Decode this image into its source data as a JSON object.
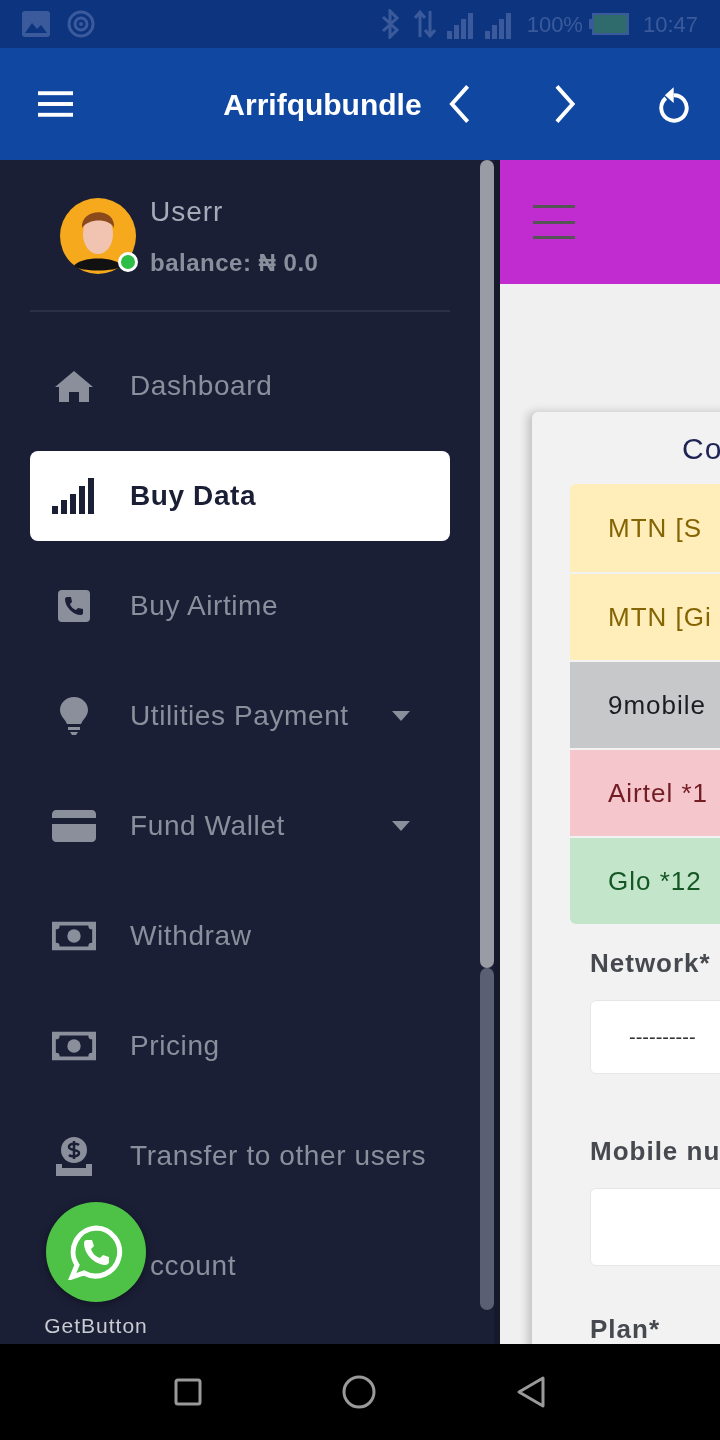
{
  "status_bar": {
    "battery": "100%",
    "time": "10:47"
  },
  "app_bar": {
    "title": "Arrifqubundle"
  },
  "profile": {
    "name": "Userr",
    "balance": "balance: ₦ 0.0",
    "online": true
  },
  "nav_items": [
    {
      "label": "Dashboard",
      "kind": "home",
      "selected": false,
      "expandable": false
    },
    {
      "label": "Buy Data",
      "kind": "signal",
      "selected": true,
      "expandable": false
    },
    {
      "label": "Buy Airtime",
      "kind": "phone",
      "selected": false,
      "expandable": false
    },
    {
      "label": "Utilities Payment",
      "kind": "bulb",
      "selected": false,
      "expandable": true
    },
    {
      "label": "Fund Wallet",
      "kind": "card",
      "selected": false,
      "expandable": true
    },
    {
      "label": "Withdraw",
      "kind": "money",
      "selected": false,
      "expandable": false
    },
    {
      "label": "Pricing",
      "kind": "money",
      "selected": false,
      "expandable": false
    },
    {
      "label": "Transfer to other users",
      "kind": "coin",
      "selected": false,
      "expandable": false
    },
    {
      "label": "ccount",
      "kind": "hidden",
      "selected": false,
      "expandable": false
    }
  ],
  "float_button": {
    "label": "GetButton"
  },
  "content": {
    "card_title": "Co",
    "networks": [
      {
        "label": "MTN [S",
        "kind": "warning"
      },
      {
        "label": "MTN [Gi",
        "kind": "warning"
      },
      {
        "label": "9mobile",
        "kind": "secondary"
      },
      {
        "label": "Airtel *1",
        "kind": "danger"
      },
      {
        "label": "Glo *12",
        "kind": "success"
      }
    ],
    "fields": [
      {
        "label": "Network*",
        "kind": "select",
        "value": "----------"
      },
      {
        "label": "Mobile nu",
        "kind": "input"
      },
      {
        "label": "Plan*",
        "kind": "none"
      }
    ]
  }
}
